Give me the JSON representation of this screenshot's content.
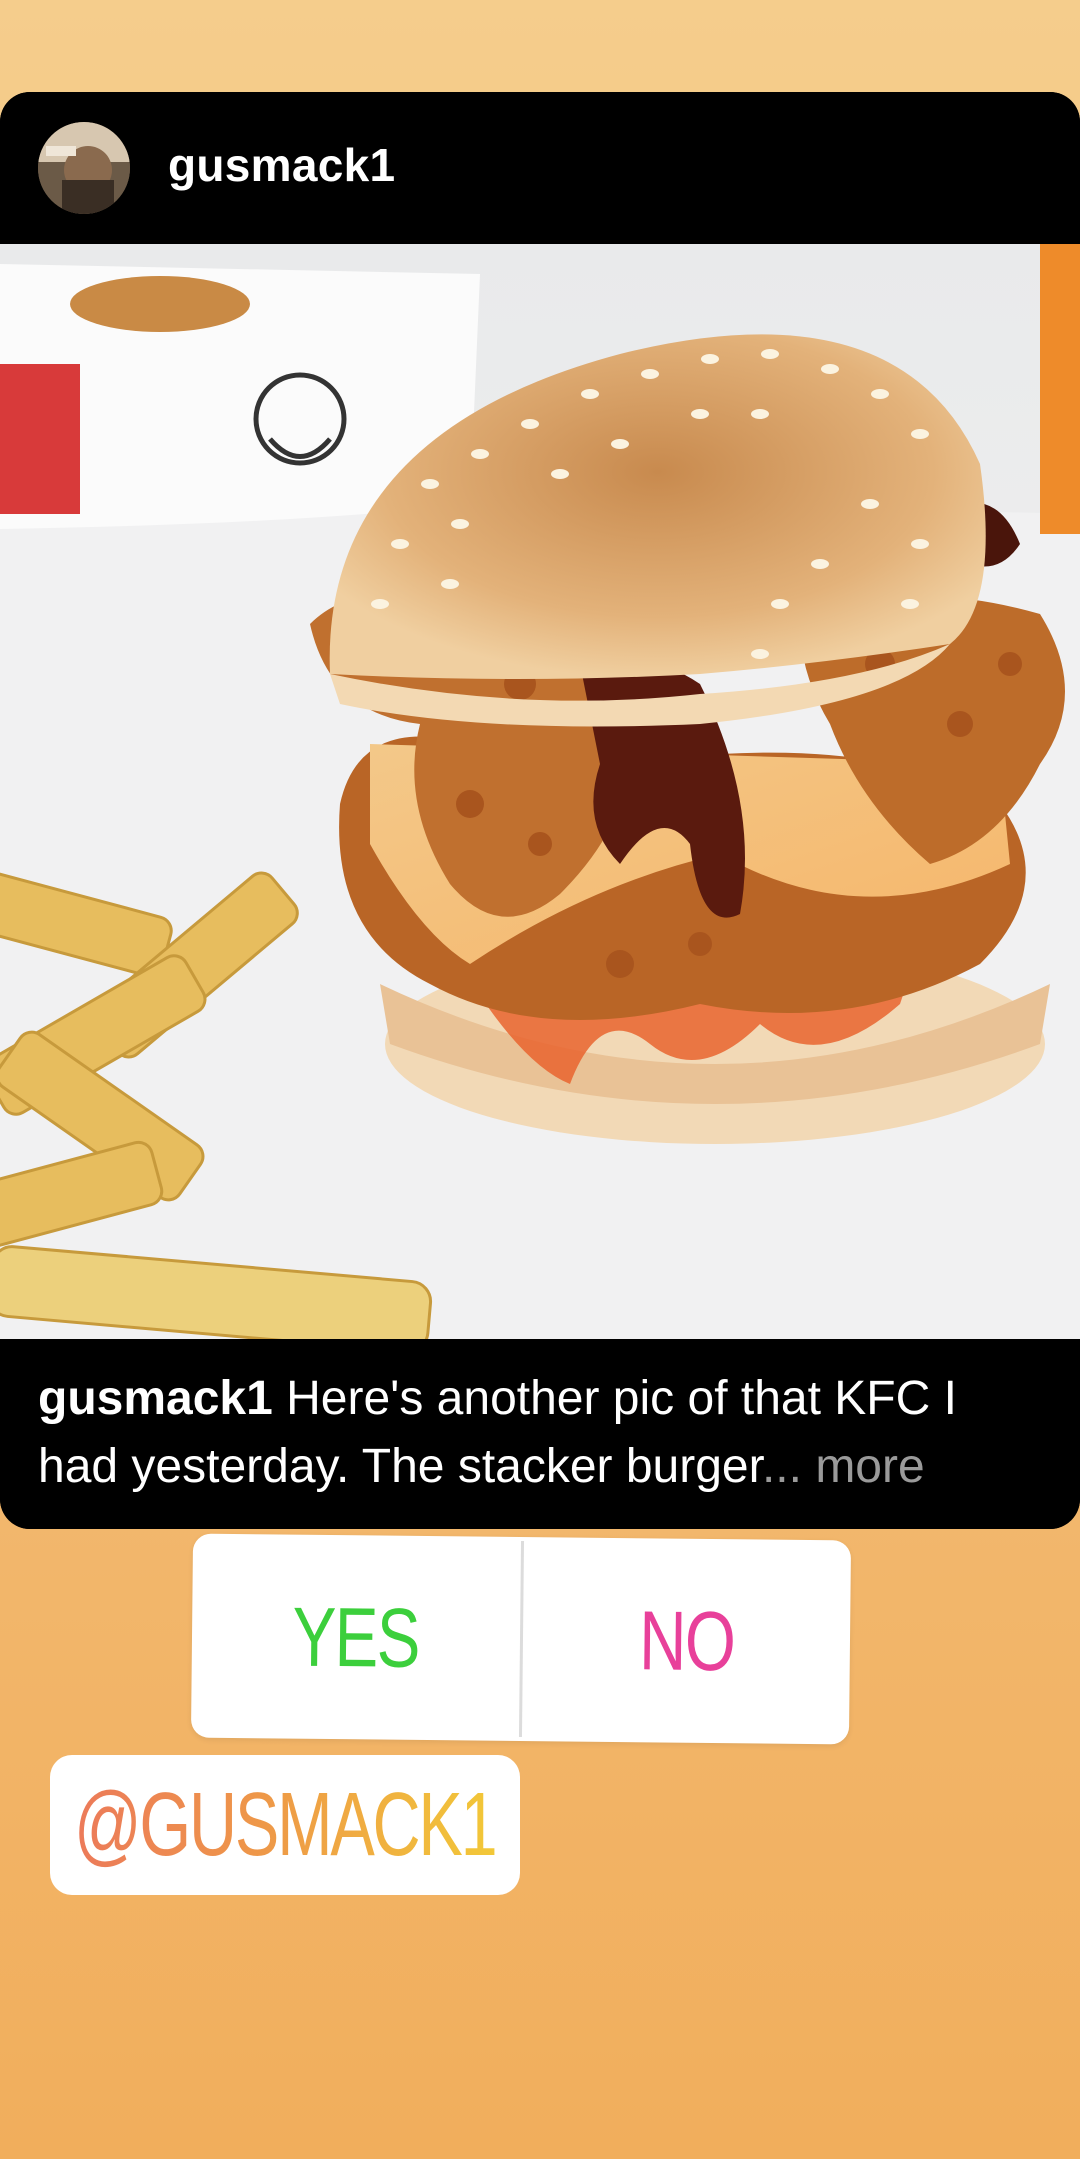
{
  "post": {
    "username": "gusmack1",
    "caption_user": "gusmack1",
    "caption_text": " Here's another pic of that KFC I had yesterday. The stacker burger",
    "caption_more": "... more"
  },
  "poll": {
    "yes_label": "YES",
    "no_label": "NO"
  },
  "mention": {
    "label": "@GUSMACK1"
  },
  "colors": {
    "yes": "#3ccf3c",
    "no": "#e8409a",
    "background_top": "#f5cd8c",
    "background_bottom": "#f1ae5c"
  },
  "icons": [
    "avatar",
    "burger-photo"
  ]
}
